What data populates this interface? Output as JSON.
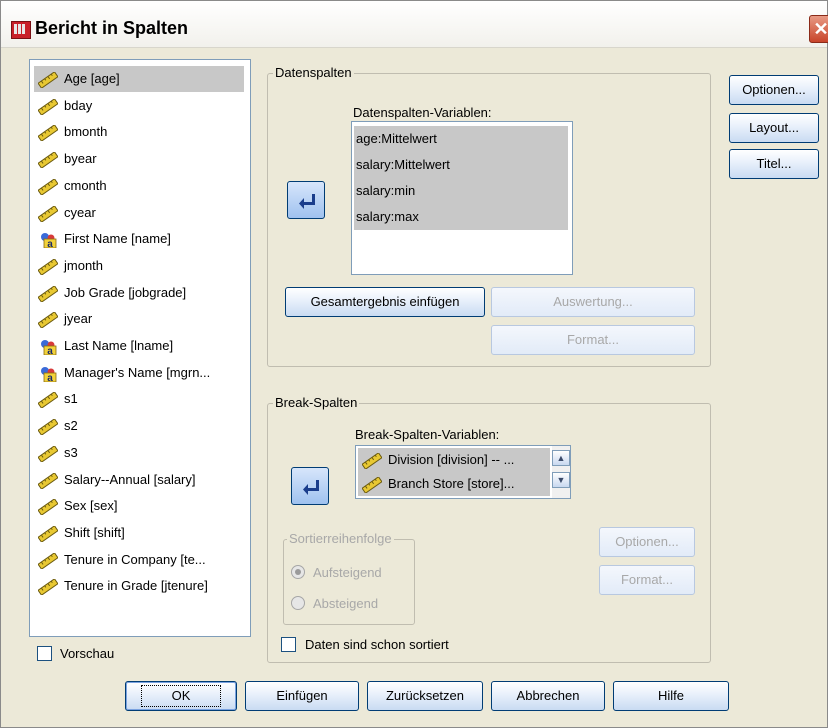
{
  "window": {
    "title": "Bericht in Spalten",
    "close_glyph": "✕"
  },
  "variables": [
    {
      "label": "Age [age]",
      "icon": "ruler-icon",
      "selected": true
    },
    {
      "label": "bday",
      "icon": "ruler-icon"
    },
    {
      "label": "bmonth",
      "icon": "ruler-icon"
    },
    {
      "label": "byear",
      "icon": "ruler-icon"
    },
    {
      "label": "cmonth",
      "icon": "ruler-icon"
    },
    {
      "label": "cyear",
      "icon": "ruler-icon"
    },
    {
      "label": "First Name [name]",
      "icon": "string-var-icon"
    },
    {
      "label": "jmonth",
      "icon": "ruler-icon"
    },
    {
      "label": "Job Grade [jobgrade]",
      "icon": "ruler-icon"
    },
    {
      "label": "jyear",
      "icon": "ruler-icon"
    },
    {
      "label": "Last Name [lname]",
      "icon": "string-var-icon"
    },
    {
      "label": "Manager's Name [mgrn...",
      "icon": "string-var-icon"
    },
    {
      "label": "s1",
      "icon": "ruler-icon"
    },
    {
      "label": "s2",
      "icon": "ruler-icon"
    },
    {
      "label": "s3",
      "icon": "ruler-icon"
    },
    {
      "label": "Salary--Annual [salary]",
      "icon": "ruler-icon"
    },
    {
      "label": "Sex [sex]",
      "icon": "ruler-icon"
    },
    {
      "label": "Shift [shift]",
      "icon": "ruler-icon"
    },
    {
      "label": "Tenure in Company [te...",
      "icon": "ruler-icon"
    },
    {
      "label": "Tenure in Grade [jtenure]",
      "icon": "ruler-icon"
    }
  ],
  "preview": {
    "label": "Vorschau",
    "checked": false
  },
  "data_columns": {
    "group_label": "Datenspalten",
    "list_label": "Datenspalten-Variablen:",
    "items": [
      "age:Mittelwert",
      "salary:Mittelwert",
      "salary:min",
      "salary:max"
    ],
    "insert_total_button": "Gesamtergebnis einfügen",
    "summary_button": "Auswertung...",
    "format_button": "Format..."
  },
  "break_columns": {
    "group_label": "Break-Spalten",
    "list_label": "Break-Spalten-Variablen:",
    "items": [
      "Division [division] -- ...",
      "Branch Store [store]..."
    ],
    "sort_group_label": "Sortierreihenfolge",
    "ascending_label": "Aufsteigend",
    "descending_label": "Absteigend",
    "ascending_checked": true,
    "options_button": "Optionen...",
    "format_button": "Format...",
    "already_sorted_label": "Daten sind schon sortiert",
    "already_sorted_checked": false
  },
  "side_buttons": {
    "options": "Optionen...",
    "layout": "Layout...",
    "title": "Titel..."
  },
  "footer": {
    "ok": "OK",
    "paste": "Einfügen",
    "reset": "Zurücksetzen",
    "cancel": "Abbrechen",
    "help": "Hilfe"
  },
  "colors": {
    "dialog_bg": "#ECE9D8",
    "selection": "#C8C8C8",
    "button_border": "#003C74",
    "close_button": "#C8442A"
  }
}
